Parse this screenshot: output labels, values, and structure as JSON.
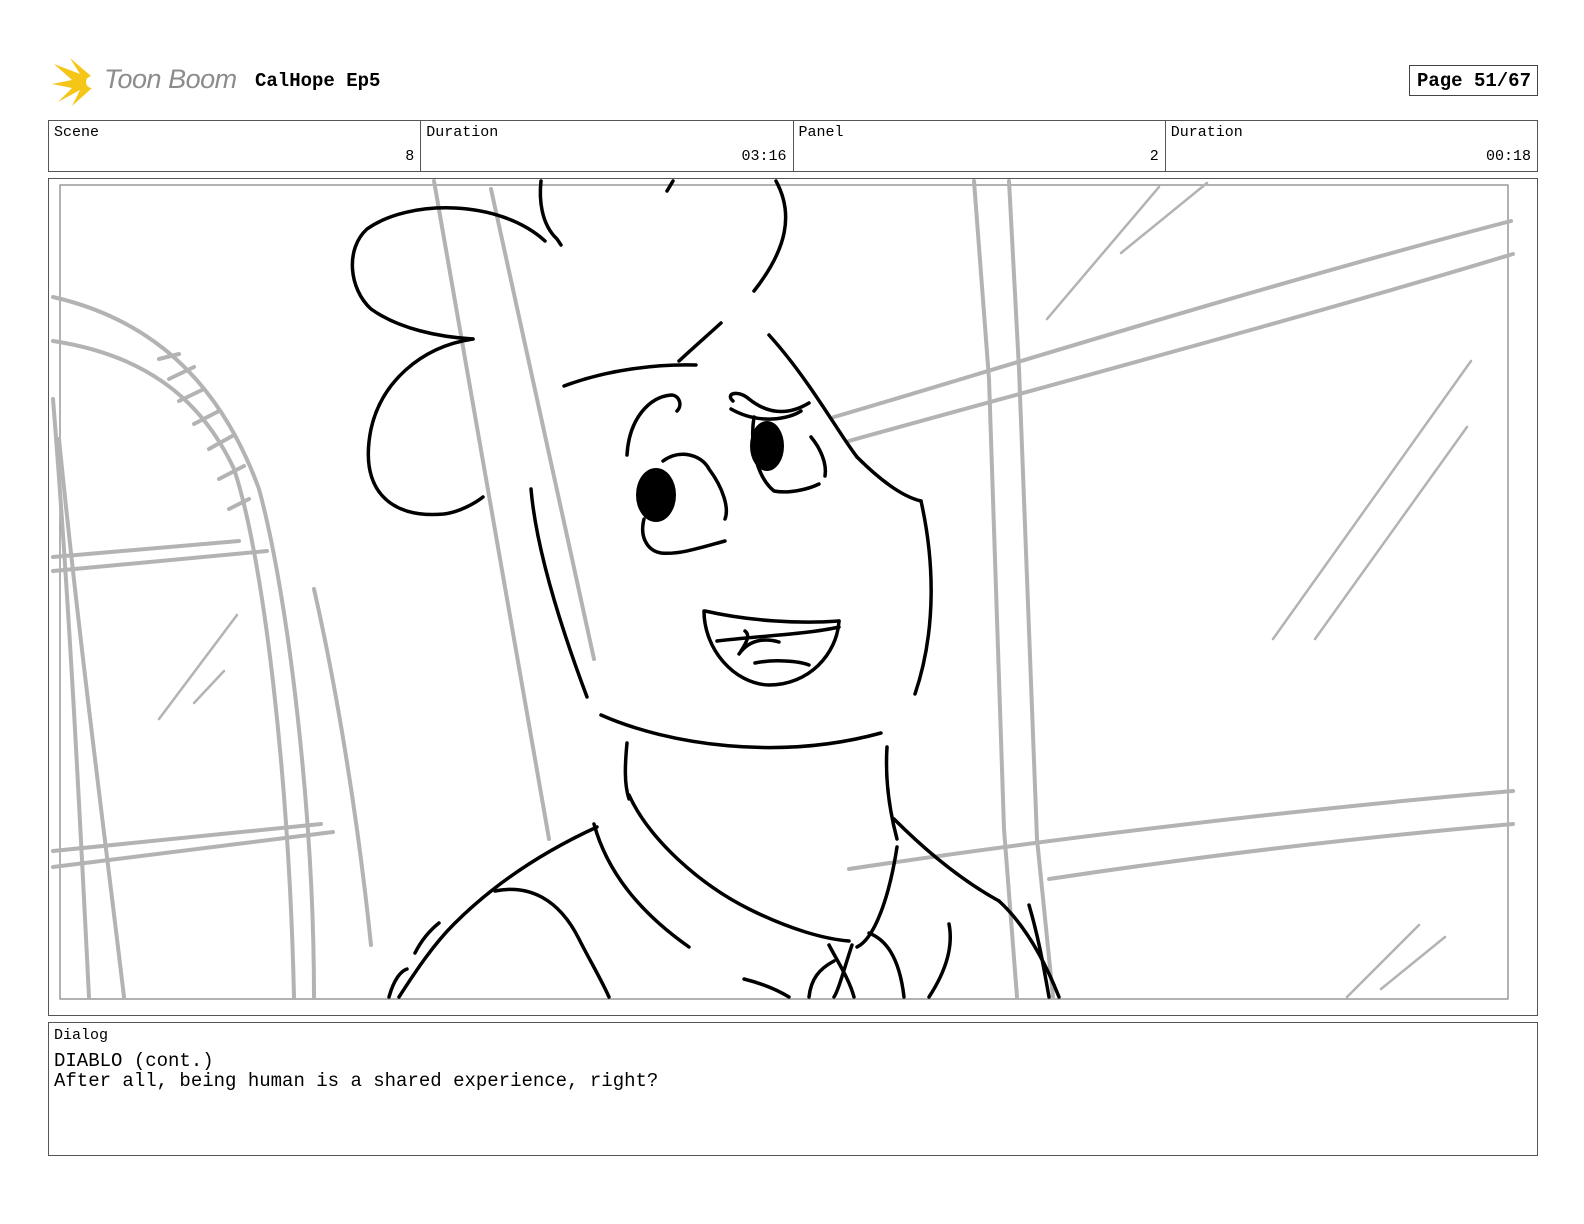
{
  "header": {
    "logo_text": "Toon Boom",
    "logo_icon": "toon-boom-burst-icon",
    "project_title": "CalHope Ep5",
    "page_label": "Page 51/67"
  },
  "info": [
    {
      "label": "Scene",
      "value": "8"
    },
    {
      "label": "Duration",
      "value": "03:16"
    },
    {
      "label": "Panel",
      "value": "2"
    },
    {
      "label": "Duration",
      "value": "00:18"
    }
  ],
  "panel": {
    "image": "storyboard-sketch-character-smiling-in-front-of-window"
  },
  "dialog": {
    "label": "Dialog",
    "speaker": "DIABLO (cont.)",
    "line": "After all, being human is a shared experience, right?"
  },
  "colors": {
    "logo_yellow": "#f5c518",
    "logo_gray": "#8c8c8c",
    "sketch_gray": "#b3b3b3",
    "ink": "#000000"
  }
}
